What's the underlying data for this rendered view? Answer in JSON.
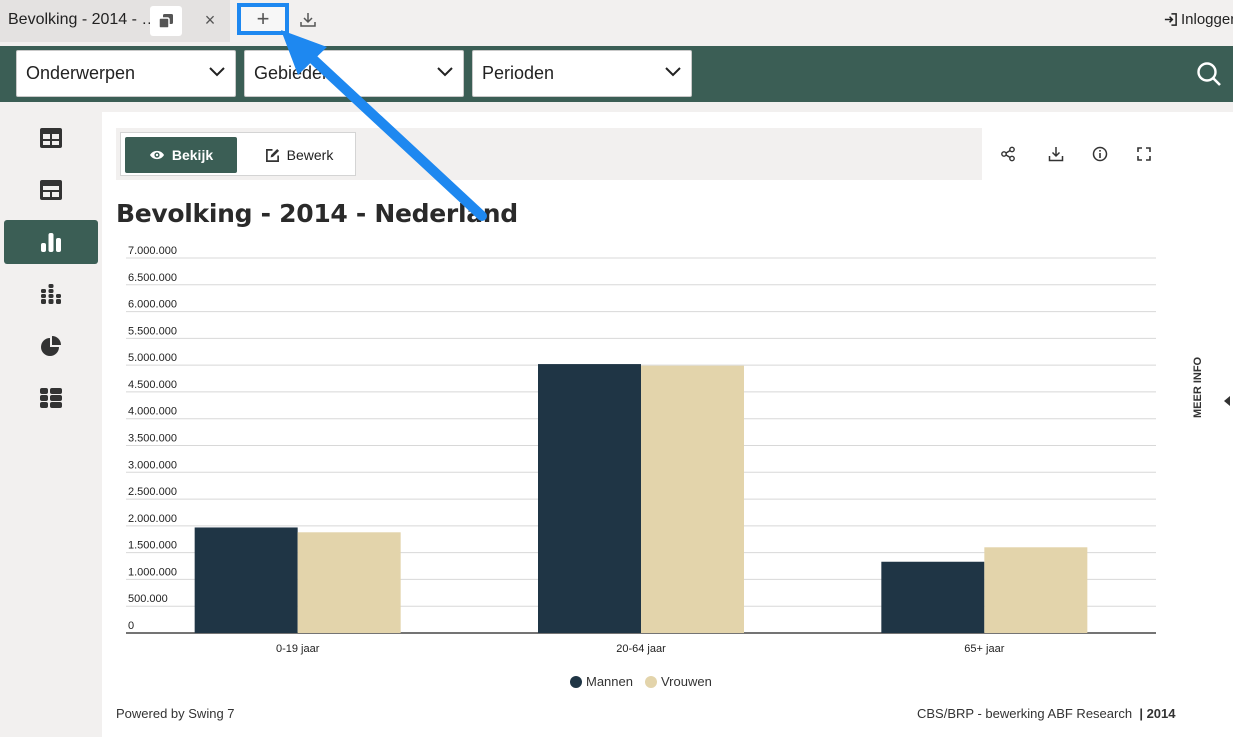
{
  "tabbar": {
    "tab_title": "Bevolking - 2014 - …",
    "close_label": "×",
    "add_label": "+",
    "login_label": "Inloggen"
  },
  "filters": {
    "subjects": "Onderwerpen",
    "areas": "Gebieden",
    "periods": "Perioden"
  },
  "toolbar": {
    "view_label": "Bekijk",
    "edit_label": "Bewerk"
  },
  "sidebar": {
    "items": [
      {
        "icon": "table-icon"
      },
      {
        "icon": "dashboard-icon"
      },
      {
        "icon": "bar-chart-icon",
        "active": true
      },
      {
        "icon": "stacked-chart-icon"
      },
      {
        "icon": "pie-chart-icon"
      },
      {
        "icon": "list-icon"
      }
    ]
  },
  "main": {
    "meer_info": "MEER INFO",
    "powered_by": "Powered by Swing 7",
    "source_text": "CBS/BRP - bewerking ABF Research",
    "source_year": "2014"
  },
  "chart_data": {
    "type": "bar",
    "title": "Bevolking - 2014 - Nederland",
    "categories": [
      "0-19 jaar",
      "20-64 jaar",
      "65+ jaar"
    ],
    "series": [
      {
        "name": "Mannen",
        "color": "#1f3545",
        "values": [
          1970000,
          5020000,
          1330000
        ]
      },
      {
        "name": "Vrouwen",
        "color": "#e3d4ab",
        "values": [
          1880000,
          4990000,
          1600000
        ]
      }
    ],
    "ylim": [
      0,
      7000000
    ],
    "yticks": [
      0,
      500000,
      1000000,
      1500000,
      2000000,
      2500000,
      3000000,
      3500000,
      4000000,
      4500000,
      5000000,
      5500000,
      6000000,
      6500000,
      7000000
    ],
    "ytick_labels": [
      "0",
      "500.000",
      "1.000.000",
      "1.500.000",
      "2.000.000",
      "2.500.000",
      "3.000.000",
      "3.500.000",
      "4.000.000",
      "4.500.000",
      "5.000.000",
      "5.500.000",
      "6.000.000",
      "6.500.000",
      "7.000.000"
    ],
    "grid": true,
    "legend_position": "bottom-center"
  },
  "colors": {
    "brand_green": "#3b5e55",
    "annotation_blue": "#1e88f0"
  }
}
